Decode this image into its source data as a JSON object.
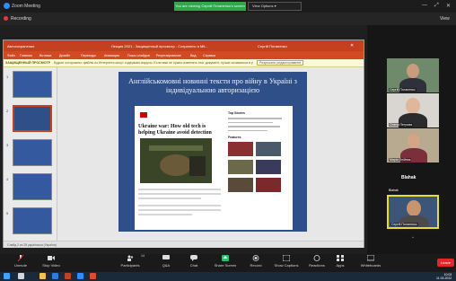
{
  "window": {
    "title": "Zoom Meeting"
  },
  "share_banner": "You are viewing Сергій Потапенко's screen",
  "view_options": "View Options",
  "win_controls": [
    "—",
    "⤢",
    "✕"
  ],
  "recording": {
    "label": "Recording"
  },
  "right_top_label": "View",
  "ppt": {
    "title_left": "Автосохранение",
    "title_center": "Лекция 2021 - Защищенный просмотр - Сохранено в Mit...",
    "title_right": "Сергій Потапенко",
    "ribbon": [
      "Файл",
      "Главная",
      "Вставка",
      "Дизайн",
      "Переходы",
      "Анимация",
      "Показ слайдов",
      "Рецензирование",
      "Вид",
      "Справка"
    ],
    "protected_label": "ЗАЩИЩЕННЫЙ ПРОСМОТР",
    "protected_msg": "Будьте осторожны: файлы из Интернета могут содержать вирусы. Если вам не нужно изменять этот документ, лучше оставаться в режиме защищенного просмотра.",
    "enable_editing": "Разрешить редактирование",
    "thumb_numbers": [
      "1",
      "2",
      "3",
      "4",
      "5"
    ],
    "status": "Слайд 2 из 28     українська (Україна)"
  },
  "slide": {
    "heading": "Англійськомовні новинні тексти про війну в Україні з індивідуальною авторизацією",
    "article_headline": "Ukraine war: How old tech is helping Ukraine avoid detection",
    "sidebar_top": "Top Stories",
    "sidebar_features": "Features"
  },
  "participants": [
    {
      "name": "Сергій Потапенко"
    },
    {
      "name": "Олена Петрова"
    },
    {
      "name": "Марія Олійник"
    },
    {
      "name": "Blahak"
    },
    {
      "name": "Сергій Потапенко"
    }
  ],
  "toolbar": {
    "items": [
      {
        "label": "Unmute",
        "icon": "microphone-icon"
      },
      {
        "label": "Stop Video",
        "icon": "camera-icon"
      },
      {
        "label": "Participants",
        "icon": "people-icon",
        "badge": "14"
      },
      {
        "label": "Q&A",
        "icon": "qa-icon"
      },
      {
        "label": "Chat",
        "icon": "chat-icon"
      },
      {
        "label": "Share Screen",
        "icon": "share-icon"
      },
      {
        "label": "Record",
        "icon": "record-icon"
      },
      {
        "label": "Show Captions",
        "icon": "cc-icon"
      },
      {
        "label": "Reactions",
        "icon": "reaction-icon"
      },
      {
        "label": "Apps",
        "icon": "apps-icon"
      },
      {
        "label": "Whiteboards",
        "icon": "whiteboard-icon"
      }
    ],
    "end": "Leave"
  },
  "taskbar": {
    "time": "10:03",
    "date": "11.03.2022"
  }
}
